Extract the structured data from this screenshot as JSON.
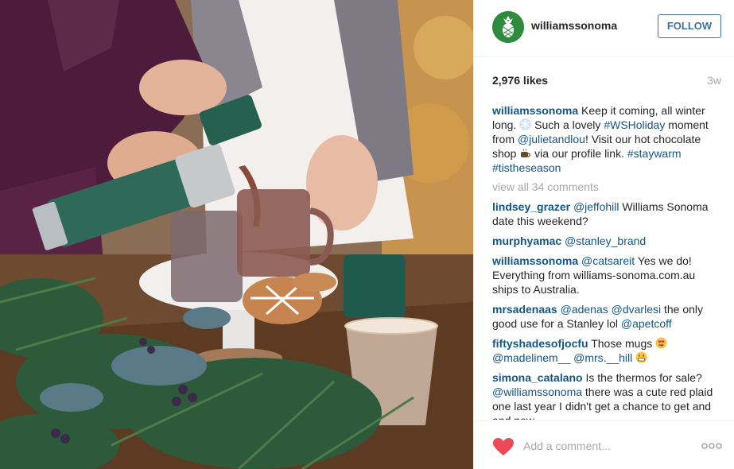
{
  "post": {
    "image_alt": "Hands pouring hot chocolate from a green thermos into glass mugs on a white cake stand with gingerbread cookies and evergreen branches"
  },
  "header": {
    "username": "williamssonoma",
    "follow_label": "FOLLOW",
    "avatar_icon": "pineapple-icon"
  },
  "meta": {
    "likes": "2,976 likes",
    "time": "3w"
  },
  "caption": {
    "user": "williamssonoma",
    "text1": "Keep it coming, all winter long.",
    "text2": "Such a lovely",
    "tag1": "#WSHoliday",
    "text3": "moment from",
    "tag2": "@julietandlou",
    "text4": "! Visit our hot chocolate shop",
    "text5": "via our profile link.",
    "tag3": "#staywarm",
    "tag4": "#tistheseason"
  },
  "view_all": "view all 34 comments",
  "comments": [
    {
      "user": "lindsey_grazer",
      "mention": "@jeffohill",
      "text": "Williams Sonoma date this weekend?"
    },
    {
      "user": "murphyamac",
      "mention": "@stanley_brand",
      "text": ""
    },
    {
      "user": "williamssonoma",
      "mention": "@catsareit",
      "text": "Yes we do! Everything from williams-sonoma.com.au ships to Australia."
    },
    {
      "user": "mrsadenaas",
      "mention": "@adenas @dvarlesi",
      "text": "the only good use for a Stanley lol",
      "mention2": "@apetcoff"
    },
    {
      "user": "fiftyshadesofjocfu",
      "text": "Those mugs",
      "mention": "@madelinem__ @mrs.__hill"
    },
    {
      "user": "simona_catalano",
      "text": "Is the thermos for sale?",
      "mention": "@williamssonoma",
      "text2": "there was a cute red plaid one last year I didn't get a chance to get and and now"
    }
  ],
  "footer": {
    "placeholder": "Add a comment...",
    "heart_icon": "heart-icon",
    "more_icon": "more-options-icon"
  },
  "colors": {
    "link": "#125688",
    "follow": "#3f729b",
    "muted": "#a5a7aa",
    "heart": "#ed4956",
    "avatar": "#2e8b3e"
  }
}
